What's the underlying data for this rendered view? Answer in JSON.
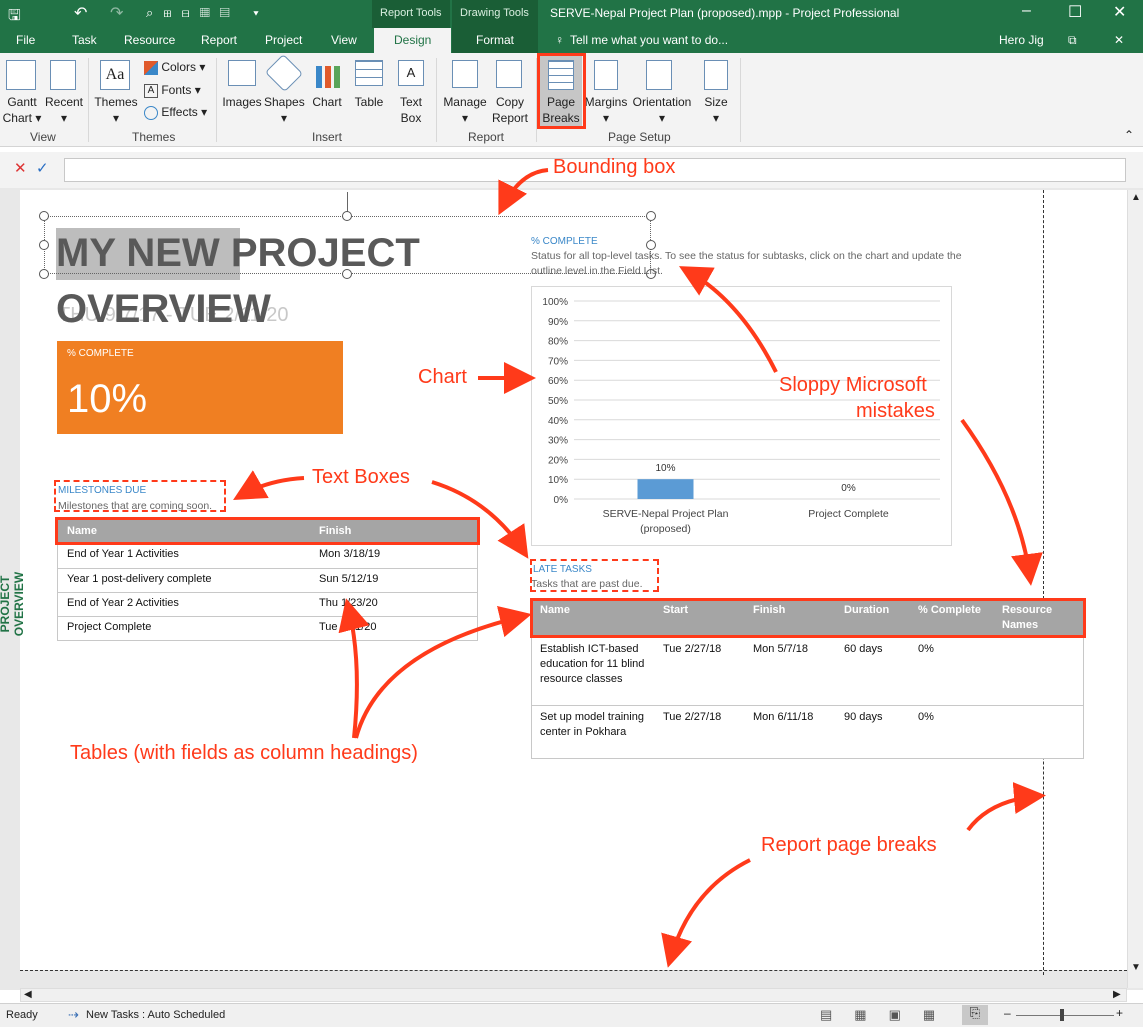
{
  "window": {
    "title": "SERVE-Nepal Project Plan (proposed).mpp - Project Professional",
    "context_report_tools": "Report Tools",
    "context_drawing_tools": "Drawing Tools"
  },
  "tabs": {
    "file": "File",
    "task": "Task",
    "resource": "Resource",
    "report": "Report",
    "project": "Project",
    "view": "View",
    "design": "Design",
    "format": "Format",
    "tell_me": "Tell me what you want to do...",
    "user": "Hero Jig"
  },
  "ribbon": {
    "gantt_chart": [
      "Gantt",
      "Chart ▾"
    ],
    "recent": [
      "Recent",
      "▾"
    ],
    "themes": [
      "Themes",
      "▾"
    ],
    "colors": "Colors ▾",
    "fonts": "Fonts ▾",
    "effects": "Effects ▾",
    "images": "Images",
    "shapes": [
      "Shapes",
      "▾"
    ],
    "chart": "Chart",
    "table": "Table",
    "text_box": [
      "Text",
      "Box"
    ],
    "manage": [
      "Manage",
      "▾"
    ],
    "copy_report": [
      "Copy",
      "Report"
    ],
    "page_breaks": [
      "Page",
      "Breaks"
    ],
    "margins": [
      "Margins",
      "▾"
    ],
    "orientation": [
      "Orientation",
      "▾"
    ],
    "size": [
      "Size",
      "▾"
    ],
    "groups": {
      "view": "View",
      "themes": "Themes",
      "insert": "Insert",
      "report": "Report",
      "page_setup": "Page Setup"
    }
  },
  "report": {
    "side_label": "PROJECT OVERVIEW",
    "title_line1_sel": "MY NEW",
    "title_line1_rest": " PROJECT",
    "title_line2": "OVERVIEW",
    "title_ghost": "THU 9/7/17 - TUE 2/11/20",
    "pct_box_label": "% COMPLETE",
    "pct_box_value": "10%",
    "pct_heading": "% COMPLETE",
    "pct_desc_line1": "Status for all top-level tasks. To see the status for subtasks, click on the chart and update the",
    "pct_desc_line2": "outline level in the Field List.",
    "milestones_heading": "MILESTONES DUE",
    "milestones_desc": "Milestones that are coming soon.",
    "milestones_table": {
      "headers": [
        "Name",
        "Finish"
      ],
      "rows": [
        [
          "End of Year 1 Activities",
          "Mon 3/18/19"
        ],
        [
          "Year 1 post-delivery complete",
          "Sun 5/12/19"
        ],
        [
          "End of Year 2 Activities",
          "Thu 1/23/20"
        ],
        [
          "Project Complete",
          "Tue 2/11/20"
        ]
      ]
    },
    "late_heading": "LATE TASKS",
    "late_desc": "Tasks that are past due.",
    "late_table": {
      "headers": [
        "Name",
        "Start",
        "Finish",
        "Duration",
        "% Complete",
        "Resource Names"
      ],
      "rows": [
        [
          "Establish ICT-based education for 11 blind resource classes",
          "Tue 2/27/18",
          "Mon 5/7/18",
          "60 days",
          "0%",
          ""
        ],
        [
          "Set up model training center in Pokhara",
          "Tue 2/27/18",
          "Mon 6/11/18",
          "90 days",
          "0%",
          ""
        ]
      ]
    }
  },
  "chart_data": {
    "type": "bar",
    "categories": [
      "SERVE-Nepal Project Plan (proposed)",
      "Project Complete"
    ],
    "values": [
      10,
      0
    ],
    "data_labels": [
      "10%",
      "0%"
    ],
    "ylim": [
      0,
      100
    ],
    "yticks": [
      "0%",
      "10%",
      "20%",
      "30%",
      "40%",
      "50%",
      "60%",
      "70%",
      "80%",
      "90%",
      "100%"
    ],
    "bar_color": "#5b9bd5",
    "grid": true
  },
  "annotations": {
    "bounding_box": "Bounding box",
    "chart": "Chart",
    "sloppy_line1": "Sloppy Microsoft",
    "sloppy_line2": "mistakes",
    "text_boxes": "Text Boxes",
    "tables": "Tables (with fields as column headings)",
    "page_breaks": "Report  page breaks"
  },
  "status": {
    "ready": "Ready",
    "new_tasks": "New Tasks : Auto Scheduled"
  },
  "colors": {
    "brand_green": "#217346",
    "orange": "#f07f22",
    "annotation_red": "#ff3a1a",
    "accent_blue": "#3a87c8"
  }
}
